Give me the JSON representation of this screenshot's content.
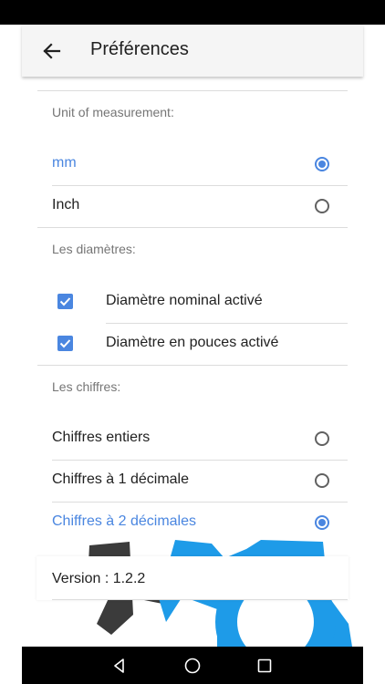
{
  "app_bar": {
    "title": "Préférences"
  },
  "sections": {
    "unit": {
      "header": "Unit of measurement:",
      "options": [
        {
          "label": "mm",
          "selected": true
        },
        {
          "label": "Inch",
          "selected": false
        }
      ]
    },
    "diameters": {
      "header": "Les diamètres:",
      "options": [
        {
          "label": "Diamètre nominal activé",
          "checked": true
        },
        {
          "label": "Diamètre en pouces activé",
          "checked": true
        }
      ]
    },
    "digits": {
      "header": "Les chiffres:",
      "options": [
        {
          "label": "Chiffres entiers",
          "selected": false
        },
        {
          "label": "Chiffres à 1 décimale",
          "selected": false
        },
        {
          "label": "Chiffres à 2 décimales",
          "selected": true
        }
      ]
    }
  },
  "version": "Version : 1.2.2",
  "colors": {
    "accent": "#4a86e0",
    "logo_blue": "#1e9be8",
    "logo_dark": "#3b3b3b"
  },
  "icons": {
    "back": "arrow-back-icon",
    "nav_back": "triangle-back-icon",
    "nav_home": "circle-home-icon",
    "nav_recents": "square-recents-icon"
  }
}
